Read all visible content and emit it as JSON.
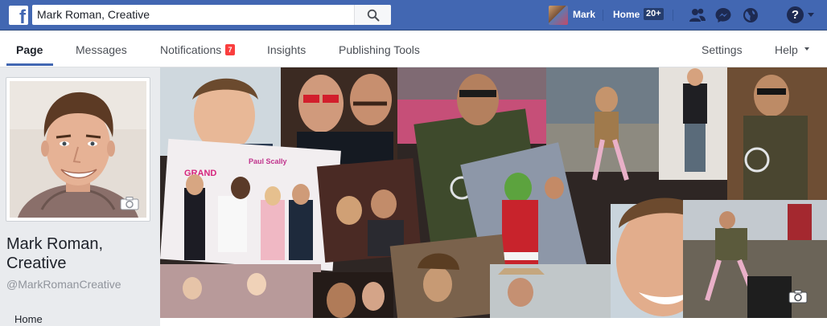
{
  "topbar": {
    "logo_glyph": "f",
    "search_value": "Mark Roman, Creative",
    "search_icon": "search-icon",
    "user_name": "Mark",
    "home_label": "Home",
    "home_count": "20+",
    "icons": [
      "friend-requests-icon",
      "messenger-icon",
      "globe-icon",
      "help-icon",
      "caret-down-icon"
    ],
    "help_glyph": "?"
  },
  "nav": {
    "tabs": [
      {
        "label": "Page",
        "active": true
      },
      {
        "label": "Messages"
      },
      {
        "label": "Notifications"
      },
      {
        "label": "Insights"
      },
      {
        "label": "Publishing Tools"
      }
    ],
    "notifications_badge": "7",
    "settings_label": "Settings",
    "help_label": "Help"
  },
  "profile": {
    "name": "Mark Roman, Creative",
    "handle": "@MarkRomanCreative",
    "menu": [
      "Home"
    ]
  },
  "colors": {
    "brand_blue": "#4267b2",
    "badge_red": "#fa3e3e",
    "page_bg": "#e9ebee"
  }
}
